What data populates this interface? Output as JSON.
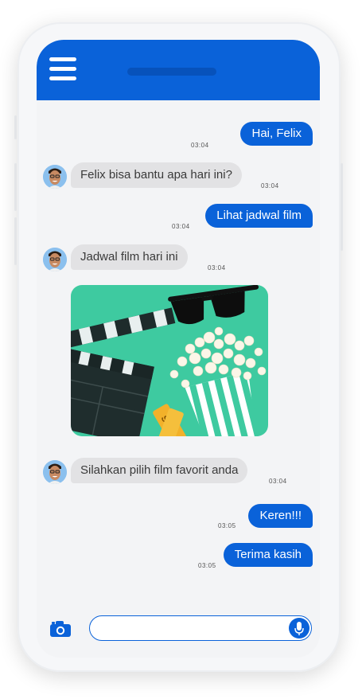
{
  "conversation": {
    "messages": [
      {
        "side": "right",
        "text": "Hai, Felix",
        "time": "03:04"
      },
      {
        "side": "left",
        "text": "Felix bisa bantu apa hari ini?",
        "time": "03:04"
      },
      {
        "side": "right",
        "text": "Lihat jadwal film",
        "time": "03:04"
      },
      {
        "side": "left",
        "text": "Jadwal film hari ini",
        "time": "03:04"
      },
      {
        "side": "left",
        "text": "Silahkan pilih film favorit anda",
        "time": "03:04"
      },
      {
        "side": "right",
        "text": "Keren!!!",
        "time": "03:05"
      },
      {
        "side": "right",
        "text": "Terima kasih",
        "time": "03:05"
      }
    ]
  },
  "image_ticket": {
    "text": "SUY"
  },
  "input": {
    "value": "",
    "placeholder": ""
  },
  "colors": {
    "accent": "#0a62d9",
    "bubble_gray": "#e2e2e4",
    "photo_bg": "#3ecaa0"
  },
  "icons": [
    "menu-icon",
    "camera-icon",
    "microphone-icon"
  ]
}
